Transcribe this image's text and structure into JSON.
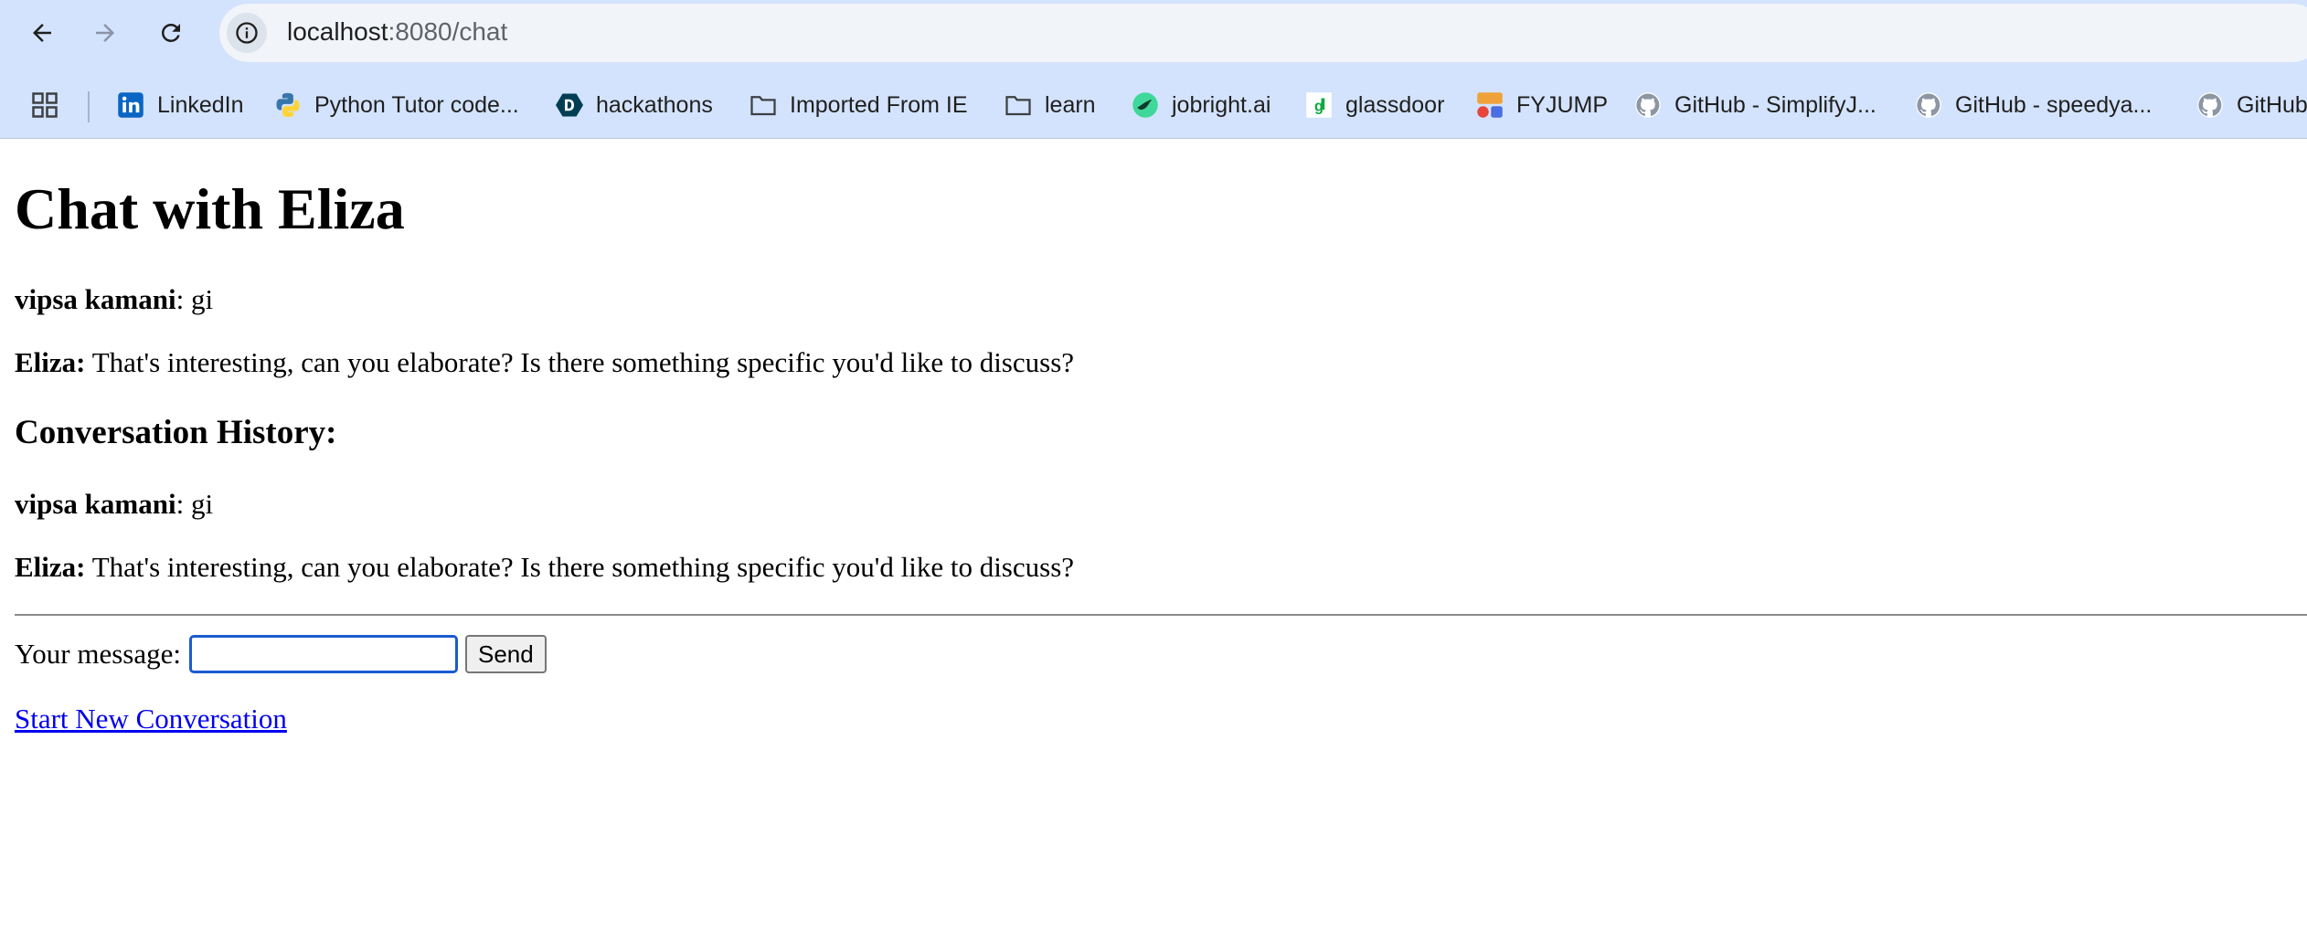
{
  "browser": {
    "url_host": "localhost",
    "url_rest": ":8080/chat",
    "bookmarks": [
      {
        "label": "LinkedIn",
        "icon": "linkedin-icon"
      },
      {
        "label": "Python Tutor code...",
        "icon": "python-icon"
      },
      {
        "label": "hackathons",
        "icon": "devpost-icon"
      },
      {
        "label": "Imported From IE",
        "icon": "folder-icon"
      },
      {
        "label": "learn",
        "icon": "folder-icon"
      },
      {
        "label": "jobright.ai",
        "icon": "jobright-icon"
      },
      {
        "label": "glassdoor",
        "icon": "glassdoor-icon"
      },
      {
        "label": "FYJUMP",
        "icon": "fyjump-icon"
      },
      {
        "label": "GitHub - SimplifyJ...",
        "icon": "github-icon"
      },
      {
        "label": "GitHub - speedya...",
        "icon": "github-icon"
      },
      {
        "label": "GitHub",
        "icon": "github-icon"
      }
    ]
  },
  "page": {
    "title": "Chat with Eliza",
    "current": {
      "user_name": "vipsa kamani",
      "user_text": ": gi",
      "bot_name": "Eliza:",
      "bot_text": " That's interesting, can you elaborate? Is there something specific you'd like to discuss?"
    },
    "history_heading": "Conversation History:",
    "history": [
      {
        "speaker": "vipsa kamani",
        "text": ": gi"
      },
      {
        "speaker": "Eliza:",
        "text": " That's interesting, can you elaborate? Is there something specific you'd like to discuss?"
      }
    ],
    "form": {
      "label": "Your message:",
      "input_value": "",
      "send_label": "Send"
    },
    "new_conversation_link": "Start New Conversation"
  },
  "colors": {
    "chrome_bg": "#d3e3fd",
    "omnibox_bg": "#f1f4f9",
    "link": "#0000ee",
    "input_focus": "#1a5bd0"
  }
}
